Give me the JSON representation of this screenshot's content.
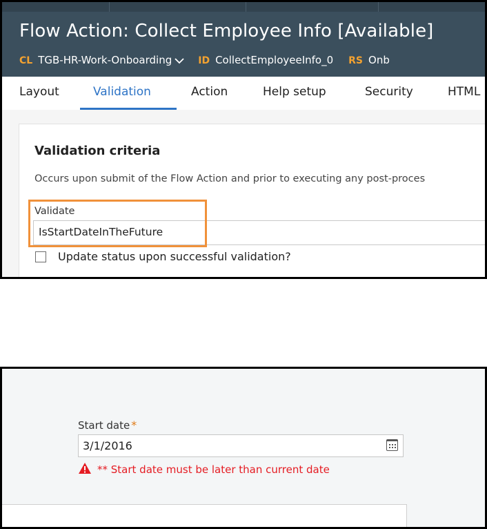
{
  "panel1": {
    "title": "Flow Action: Collect Employee Info [Available]",
    "meta": [
      {
        "tag": "CL",
        "value": "TGB-HR-Work-Onboarding"
      },
      {
        "tag": "ID",
        "value": "CollectEmployeeInfo_0"
      },
      {
        "tag": "RS",
        "value": "Onb"
      }
    ],
    "tabs": [
      "Layout",
      "Validation",
      "Action",
      "Help setup",
      "Security",
      "HTML"
    ],
    "active_tab": "Validation",
    "section": {
      "title": "Validation criteria",
      "description": "Occurs upon submit of the Flow Action and prior to executing any post-proces",
      "validate_label": "Validate",
      "validate_value": "IsStartDateInTheFuture",
      "checkbox_label": "Update status upon successful validation?",
      "checkbox_checked": false
    }
  },
  "panel2": {
    "start_label": "Start date",
    "required_mark": "*",
    "start_value": "3/1/2016",
    "error_message": "** Start date must be later than current date"
  },
  "colors": {
    "header_bg": "#3b4f5d",
    "tag_orange": "#f3a230",
    "active_tab_blue": "#2e74c6",
    "highlight_orange": "#f0913a",
    "error_red": "#e51c23",
    "required_orange": "#e07b17"
  },
  "icons": {
    "dropdown": "chevron-down-icon",
    "calendar": "calendar-icon",
    "warning": "warning-icon"
  }
}
